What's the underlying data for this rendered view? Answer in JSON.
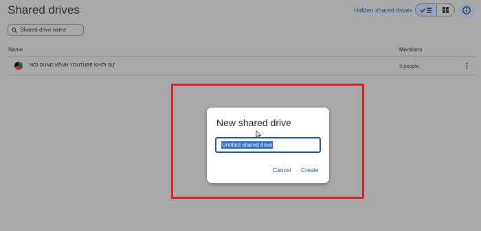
{
  "header": {
    "title": "Shared drives",
    "hidden_link": "Hidden shared drives"
  },
  "view_toggle": {
    "list_icon": "check-list-icon",
    "grid_icon": "grid-icon",
    "selected": "list"
  },
  "info_icon": "info-icon",
  "search": {
    "placeholder": "Shared drive name",
    "value": ""
  },
  "table": {
    "columns": [
      "Name",
      "Members"
    ],
    "rows": [
      {
        "name": "NỘI DUNG KÊNH YOUTUBE KHỞI SỰ",
        "members": "3 people"
      }
    ]
  },
  "dialog": {
    "title": "New shared drive",
    "input_value": "Untitled shared drive",
    "cancel_label": "Cancel",
    "create_label": "Create"
  },
  "colors": {
    "accent": "#1a56a8",
    "highlight_border": "#d61f26",
    "scrim": "#a9a9a9"
  }
}
